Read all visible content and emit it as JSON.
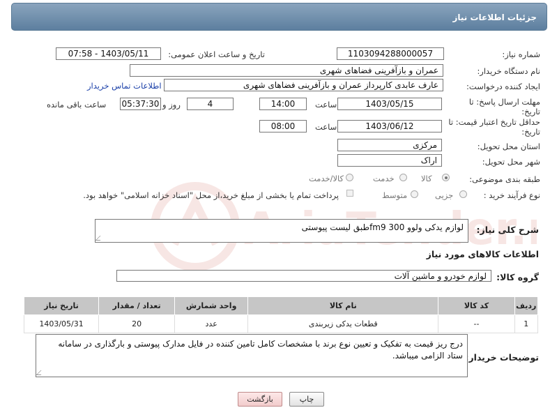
{
  "header": {
    "title": "جزئیات اطلاعات نیاز"
  },
  "fields": {
    "need_number_label": "شماره نیاز:",
    "need_number": "1103094288000057",
    "announce_label": "تاریخ و ساعت اعلان عمومی:",
    "announce_value": "1403/05/11 - 07:58",
    "buyer_org_label": "نام دستگاه خریدار:",
    "buyer_org": "عمران و بازآفرینی فضاهای شهری",
    "creator_label": "ایجاد کننده درخواست:",
    "creator": "عارف عابدی کارپرداز عمران و بازآفرینی فضاهای شهری",
    "contact_link": "اطلاعات تماس خریدار",
    "deadline_label_1": "مهلت ارسال پاسخ: تا",
    "deadline_label_2": "تاریخ:",
    "deadline_date": "1403/05/15",
    "time_label": "ساعت",
    "deadline_time": "14:00",
    "days_value": "4",
    "days_label": "روز و",
    "remaining_time": "05:37:30",
    "remaining_label": "ساعت باقی مانده",
    "validity_label_1": "حداقل تاریخ اعتبار قیمت: تا",
    "validity_label_2": "تاریخ:",
    "validity_date": "1403/06/12",
    "validity_time": "08:00",
    "province_label": "استان محل تحویل:",
    "province": "مرکزی",
    "city_label": "شهر محل تحویل:",
    "city": "اراک",
    "category_label": "طبقه بندی موضوعی:",
    "category_options": [
      "کالا",
      "خدمت",
      "کالا/خدمت"
    ],
    "category_selected": "کالا",
    "purchase_label": "نوع فرآیند خرید :",
    "purchase_options": [
      "جزیی",
      "متوسط"
    ],
    "payment_note": "پرداخت تمام یا بخشی از مبلغ خرید،از محل \"اسناد خزانه اسلامی\" خواهد بود."
  },
  "description": {
    "label": "شرح کلی نیاز:",
    "value": "لوازم یدکی ولوو fm9 300طبق لیست پیوستی"
  },
  "goods": {
    "section_title": "اطلاعات کالاهای مورد نیاز",
    "group_label": "گروه کالا:",
    "group_value": "لوازم خودرو و ماشین آلات",
    "columns": [
      "ردیف",
      "کد کالا",
      "نام کالا",
      "واحد شمارش",
      "تعداد / مقدار",
      "تاریخ نیاز"
    ],
    "rows": [
      {
        "row": "1",
        "code": "--",
        "name": "قطعات یدکی زیربندی",
        "unit": "عدد",
        "qty": "20",
        "date": "1403/05/31"
      }
    ]
  },
  "buyer_notes": {
    "label": "توضیحات خریدار:",
    "value": "درج ریز قیمت به تفکیک و تعیین نوع برند با مشخصات کامل تامین کننده در فایل مدارک پیوستی و بارگذاری در سامانه ستاد الزامی میباشد."
  },
  "buttons": {
    "print": "چاپ",
    "back": "بازگشت"
  },
  "watermark": "AriaTender.neT",
  "colors": {
    "header": "#6f8fad",
    "link": "#1a3fa8",
    "table_header": "#c6c6c6"
  }
}
